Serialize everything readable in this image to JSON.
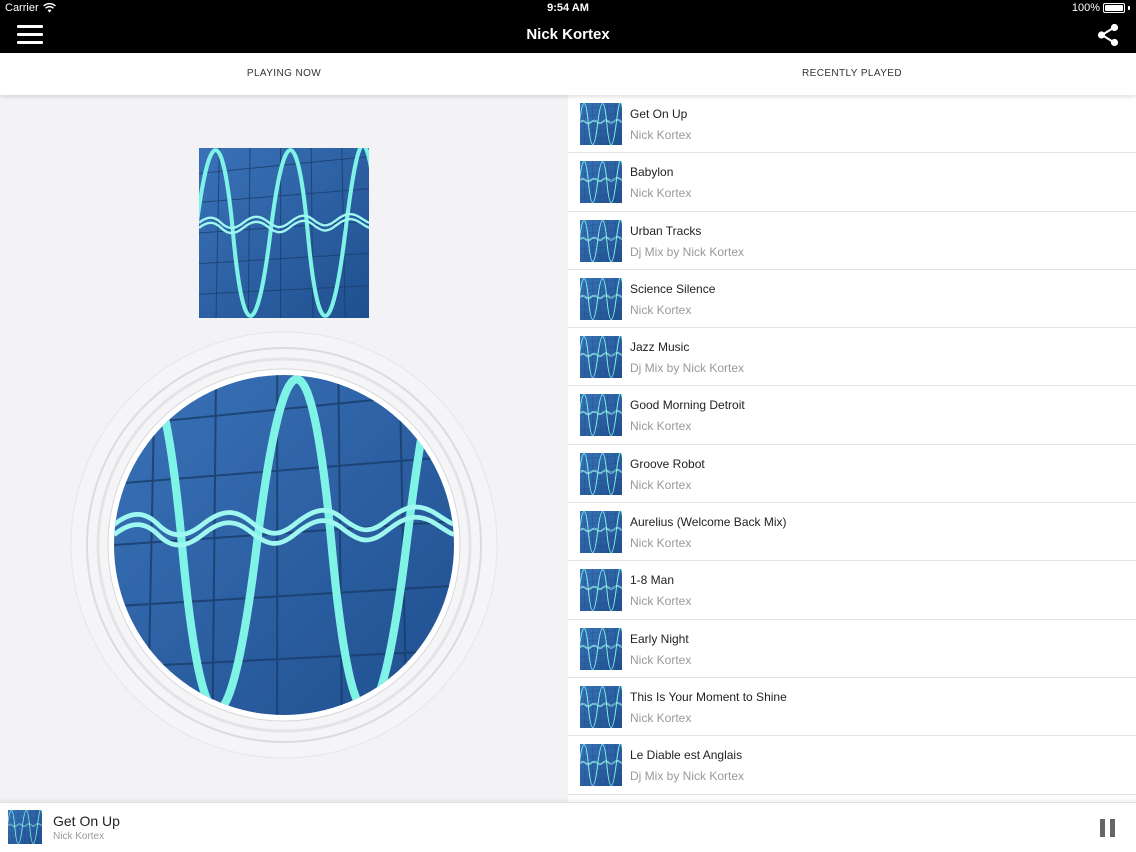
{
  "status": {
    "carrier": "Carrier",
    "time": "9:54 AM",
    "battery": "100%"
  },
  "navbar": {
    "title": "Nick Kortex",
    "menu_icon": "hamburger-icon",
    "share_icon": "share-icon"
  },
  "tabs": [
    {
      "label": "PLAYING NOW"
    },
    {
      "label": "RECENTLY PLAYED"
    }
  ],
  "recent": [
    {
      "title": "Get On Up",
      "artist": "Nick Kortex"
    },
    {
      "title": "Babylon",
      "artist": "Nick Kortex"
    },
    {
      "title": "Urban Tracks",
      "artist": "Dj Mix by Nick Kortex"
    },
    {
      "title": "Science Silence",
      "artist": "Nick Kortex"
    },
    {
      "title": "Jazz Music",
      "artist": "Dj Mix by Nick Kortex"
    },
    {
      "title": "Good Morning Detroit",
      "artist": "Nick Kortex"
    },
    {
      "title": "Groove Robot",
      "artist": "Nick Kortex"
    },
    {
      "title": "Aurelius (Welcome Back Mix)",
      "artist": "Nick Kortex"
    },
    {
      "title": "1-8 Man",
      "artist": "Nick Kortex"
    },
    {
      "title": "Early Night",
      "artist": "Nick Kortex"
    },
    {
      "title": "This Is Your Moment to Shine",
      "artist": "Nick Kortex"
    },
    {
      "title": "Le Diable est Anglais",
      "artist": "Dj Mix by Nick Kortex"
    }
  ],
  "mini_player": {
    "title": "Get On Up",
    "artist": "Nick Kortex",
    "control_icon": "pause-icon"
  },
  "colors": {
    "bar": "#000000",
    "wave_bg": "#2e63a8",
    "wave": "#7ff3e6"
  }
}
